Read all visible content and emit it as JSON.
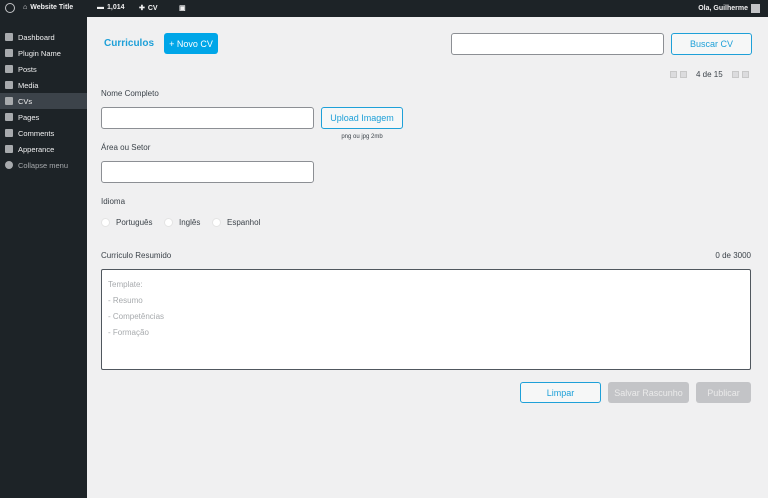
{
  "adminbar": {
    "site_title": "Website Title",
    "comments_count": "1,014",
    "new_label": "CV",
    "greeting": "Ola, Guilherme"
  },
  "sidebar": {
    "items": [
      {
        "label": "Dashboard",
        "icon": "dashboard-icon"
      },
      {
        "label": "Plugin Name",
        "icon": "plugin-icon"
      },
      {
        "label": "Posts",
        "icon": "pin-icon"
      },
      {
        "label": "Media",
        "icon": "media-icon"
      },
      {
        "label": "CVs",
        "icon": "document-icon",
        "active": true
      },
      {
        "label": "Pages",
        "icon": "page-icon"
      },
      {
        "label": "Comments",
        "icon": "comment-icon"
      },
      {
        "label": "Apperance",
        "icon": "brush-icon"
      },
      {
        "label": "Collapse menu",
        "icon": "collapse-icon"
      }
    ]
  },
  "header": {
    "title": "Curriculos",
    "new_button": "+ Novo CV",
    "search_value": "",
    "search_button": "Buscar CV"
  },
  "pagination": {
    "text": "4 de 15"
  },
  "form": {
    "name_label": "Nome Completo",
    "name_value": "",
    "upload_button": "Upload Imagem",
    "upload_hint": "png ou jpg 2mb",
    "area_label": "Área ou Setor",
    "area_value": "",
    "language_label": "Idioma",
    "languages": [
      "Português",
      "Inglês",
      "Espanhol"
    ],
    "summary_label": "Curriculo Resumido",
    "summary_count": "0 de 3000",
    "summary_placeholder": [
      "Template:",
      "- Resumo",
      "- Competências",
      "- Formação"
    ]
  },
  "actions": {
    "clear": "Limpar",
    "draft": "Salvar Rascunho",
    "publish": "Publicar"
  },
  "colors": {
    "accent": "#00a6e8",
    "adminbar": "#1d2327",
    "background": "#f0f0f1"
  }
}
